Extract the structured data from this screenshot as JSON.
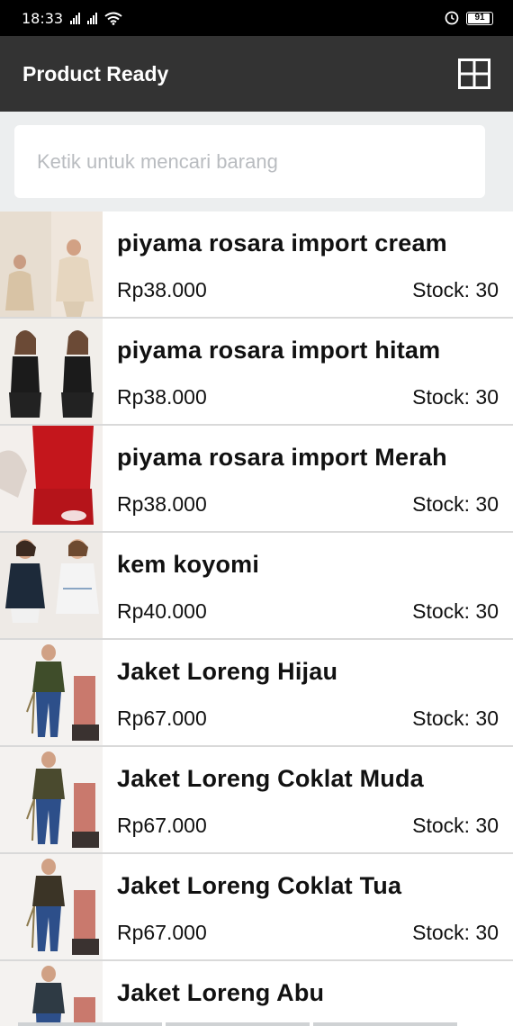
{
  "status_bar": {
    "time": "18:33",
    "battery": "91"
  },
  "app_bar": {
    "title": "Product Ready",
    "view_toggle_icon": "grid-view-icon"
  },
  "search": {
    "placeholder": "Ketik untuk mencari barang",
    "value": ""
  },
  "products": [
    {
      "name": "piyama rosara import cream",
      "price": "Rp38.000",
      "stock": "Stock: 30",
      "thumb": "cream"
    },
    {
      "name": "piyama rosara import hitam",
      "price": "Rp38.000",
      "stock": "Stock: 30",
      "thumb": "black"
    },
    {
      "name": "piyama rosara import Merah",
      "price": "Rp38.000",
      "stock": "Stock: 30",
      "thumb": "red"
    },
    {
      "name": "kem koyomi",
      "price": "Rp40.000",
      "stock": "Stock: 30",
      "thumb": "koyomi"
    },
    {
      "name": "Jaket Loreng Hijau",
      "price": "Rp67.000",
      "stock": "Stock: 30",
      "thumb": "jacket"
    },
    {
      "name": "Jaket Loreng Coklat Muda",
      "price": "Rp67.000",
      "stock": "Stock: 30",
      "thumb": "jacket"
    },
    {
      "name": "Jaket Loreng Coklat Tua",
      "price": "Rp67.000",
      "stock": "Stock: 30",
      "thumb": "jacket"
    },
    {
      "name": "Jaket Loreng Abu",
      "price": "",
      "stock": "",
      "thumb": "jacket"
    }
  ]
}
